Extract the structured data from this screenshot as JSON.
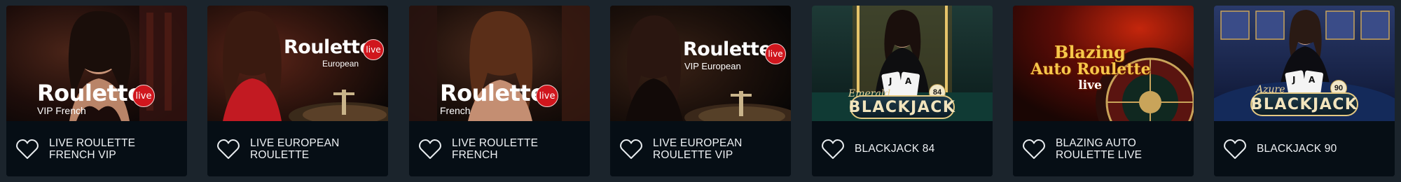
{
  "cards": [
    {
      "name": "LIVE ROULETTE FRENCH VIP",
      "logo": {
        "title": "Roulette",
        "badge": "live",
        "subtitle": "VIP French"
      }
    },
    {
      "name": "LIVE EUROPEAN ROULETTE",
      "logo": {
        "title": "Roulette",
        "badge": "live",
        "subtitle": "European"
      }
    },
    {
      "name": "LIVE ROULETTE FRENCH",
      "logo": {
        "title": "Roulette",
        "badge": "live",
        "subtitle": "French"
      }
    },
    {
      "name": "LIVE EUROPEAN ROULETTE VIP",
      "logo": {
        "title": "Roulette",
        "badge": "live",
        "subtitle": "VIP European"
      }
    },
    {
      "name": "BLACKJACK 84",
      "logo": {
        "script": "Emerald",
        "title": "BLACKJACK",
        "table_number": "84"
      }
    },
    {
      "name": "BLAZING AUTO ROULETTE LIVE",
      "logo": {
        "line1": "Blazing",
        "line2": "Auto Roulette",
        "line3": "live"
      }
    },
    {
      "name": "BLACKJACK 90",
      "logo": {
        "script": "Azure",
        "title": "BLACKJACK",
        "table_number": "90"
      }
    }
  ],
  "icons": {
    "favorite": "heart-outline-icon"
  },
  "colors": {
    "page_background": "#1b242c",
    "card_footer": "#060e15",
    "text": "#eef1f4",
    "live_badge": "#d0161d",
    "blackjack_gold": "#e4c983"
  }
}
